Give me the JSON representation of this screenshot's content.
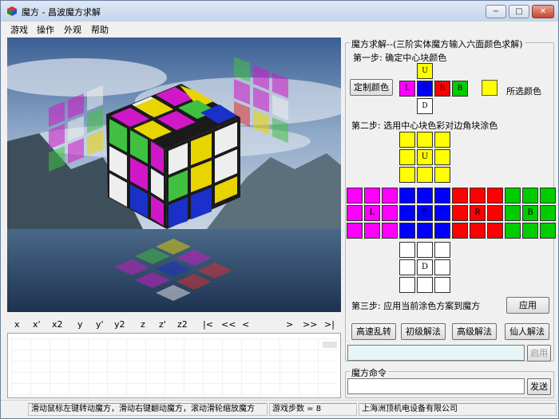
{
  "window": {
    "title": "魔方 - 昌波魔方求解",
    "controls": {
      "minimize": "−",
      "maximize": "□",
      "close": "✕"
    }
  },
  "menu": [
    "游戏",
    "操作",
    "外观",
    "帮助"
  ],
  "moves": [
    "x",
    "x'",
    "x2",
    "y",
    "y'",
    "y2",
    "z",
    "z'",
    "z2",
    "|<",
    "<<",
    "<",
    ">",
    ">>",
    ">|"
  ],
  "panel": {
    "group_title": "魔方求解--(三阶实体魔方输入六面颜色求解)",
    "step1": "第一步: 确定中心块颜色",
    "custom_color_button": "定制颜色",
    "selected_color_label": "所选颜色",
    "center_letters": {
      "up": "U",
      "left": "L",
      "front": "F",
      "right": "R",
      "back": "B",
      "down": "D"
    },
    "step2": "第二步: 选用中心块色彩对边角块涂色",
    "step3": "第三步: 应用当前涂色方案到魔方",
    "apply_button": "应用",
    "solve_buttons": [
      "高速乱转",
      "初级解法",
      "高级解法",
      "仙人解法"
    ],
    "result_input_value": "",
    "enable_button": "启用",
    "command_group_title": "魔方命令",
    "command_input_value": "",
    "send_button": "发送"
  },
  "colors": {
    "up": "#ffff00",
    "left": "#ff00ff",
    "front": "#0000ff",
    "right": "#ff0000",
    "back": "#00cc00",
    "down": "#ffffff",
    "cube_yellow": "#e8d400",
    "cube_blue": "#1a30c8",
    "cube_magenta": "#d018c8",
    "cube_green": "#40c040",
    "cube_white": "#eeeeee",
    "cube_red": "#e03030",
    "sky": "#5a7fae",
    "water": "#2d4a6c"
  },
  "net_letters": {
    "U": "U",
    "L": "L",
    "F": "F",
    "R": "R",
    "B": "B",
    "D": "D"
  },
  "status": {
    "hint": "滑动鼠标左键转动魔方，滑动右键翻动魔方，滚动滑轮缩放魔方",
    "steps": "游戏步数 = 8",
    "company": "上海洲顶机电设备有限公司"
  }
}
